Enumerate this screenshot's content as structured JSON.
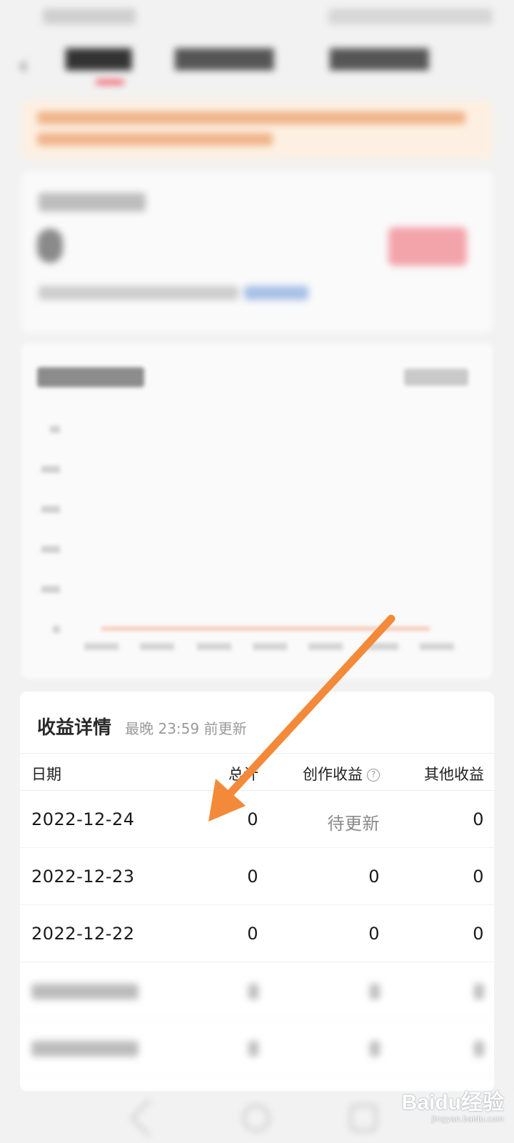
{
  "details": {
    "title": "收益详情",
    "subtitle": "最晚 23:59 前更新",
    "columns": {
      "date": "日期",
      "total": "总计",
      "create": "创作收益",
      "other": "其他收益",
      "help_icon": "?"
    },
    "rows": [
      {
        "date": "2022-12-24",
        "total": "0",
        "create": "待更新",
        "other": "0"
      },
      {
        "date": "2022-12-23",
        "total": "0",
        "create": "0",
        "other": "0"
      },
      {
        "date": "2022-12-22",
        "total": "0",
        "create": "0",
        "other": "0"
      }
    ]
  },
  "watermark": {
    "text": "Baidu经验",
    "url": "jingyan.baidu.com"
  },
  "colors": {
    "accent": "#f0444f",
    "arrow": "#f38a3a",
    "chart_line": "#f6b59a",
    "link": "#3a6fd8"
  },
  "icons": {
    "back": "chevron-left-icon",
    "help": "question-circle-icon",
    "nav_back": "triangle-back-icon",
    "nav_home": "circle-home-icon",
    "nav_recent": "square-recent-icon"
  }
}
